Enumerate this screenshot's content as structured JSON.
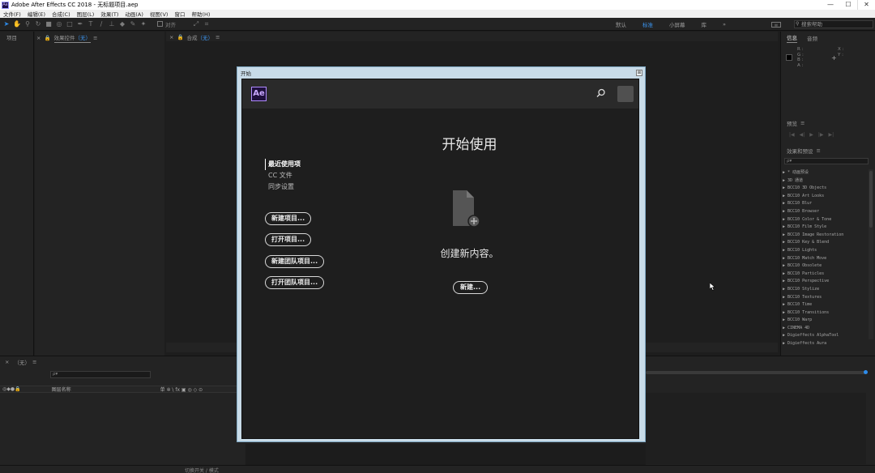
{
  "titlebar": {
    "app_icon": "Ae",
    "title": "Adobe After Effects CC 2018 - 无标题项目.aep",
    "min": "—",
    "max": "☐",
    "close": "✕"
  },
  "menu": [
    "文件(F)",
    "编辑(E)",
    "合成(C)",
    "图层(L)",
    "效果(T)",
    "动画(A)",
    "视图(V)",
    "窗口",
    "帮助(H)"
  ],
  "toolbar": {
    "snap_label": "对齐",
    "workspaces": [
      "默认",
      "标准",
      "小屏幕",
      "库"
    ],
    "active_workspace": "标准",
    "more": "»",
    "search_placeholder": "搜索帮助"
  },
  "panels": {
    "project_tab": "项目",
    "effects_control_tab": "效果控件",
    "effects_control_target": "（无）",
    "comp_tab": "合成",
    "comp_target": "（无）",
    "info_tab": "信息",
    "audio_tab": "音频",
    "info_rgba": [
      "R :",
      "G :",
      "B :",
      "A :"
    ],
    "info_xy": [
      "X :",
      "Y :"
    ],
    "preview_tab": "预览",
    "effects_presets_tab": "效果和预设",
    "effects_presets_search": "ρ▾",
    "effects_list": [
      "▶ * 动画预设",
      "▶ 3D 通道",
      "▶ BCC10 3D Objects",
      "▶ BCC10 Art Looks",
      "▶ BCC10 Blur",
      "▶ BCC10 Browser",
      "▶ BCC10 Color & Tone",
      "▶ BCC10 Film Style",
      "▶ BCC10 Image Restoration",
      "▶ BCC10 Key & Blend",
      "▶ BCC10 Lights",
      "▶ BCC10 Match Move",
      "▶ BCC10 Obsolete",
      "▶ BCC10 Particles",
      "▶ BCC10 Perspective",
      "▶ BCC10 Stylize",
      "▶ BCC10 Textures",
      "▶ BCC10 Time",
      "▶ BCC10 Transitions",
      "▶ BCC10 Warp",
      "▶ CINEMA 4D",
      "▶ Digieffects AlphaTool",
      "▶ Digieffects Aura"
    ]
  },
  "timeline": {
    "tab": "（无）",
    "search_placeholder": "ρ▾",
    "layer_header_icons": "◎◆●🔒",
    "layer_header_label": "图层名称",
    "layer_switches": "单 ✲ \\ fx ▣ ◎ ◇ ⊙",
    "toggle_label": "切换开关 / 模式"
  },
  "start": {
    "dialog_title": "开始",
    "close": "⊠",
    "badge": "Ae",
    "heading": "开始使用",
    "nav": [
      "最近使用项",
      "CC 文件",
      "同步设置"
    ],
    "buttons": [
      "新建项目...",
      "打开项目...",
      "新建团队项目...",
      "打开团队项目..."
    ],
    "create_text": "创建新内容。",
    "new_button": "新建..."
  }
}
